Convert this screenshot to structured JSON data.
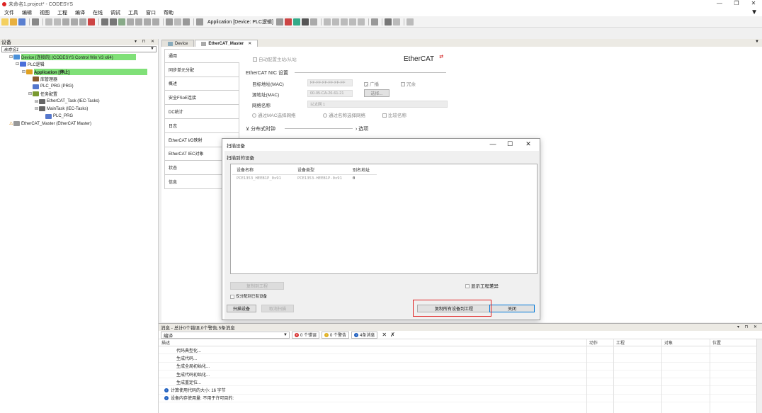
{
  "window": {
    "title": "未命名1.project* - CODESYS",
    "controls": [
      "—",
      "❐",
      "✕"
    ]
  },
  "menu": [
    "文件",
    "编辑",
    "视图",
    "工程",
    "编译",
    "在线",
    "调试",
    "工具",
    "窗口",
    "帮助"
  ],
  "toolbar": {
    "application_label": "Application [Device: PLC逻辑]"
  },
  "devices_panel": {
    "title": "设备",
    "root": "未命名1",
    "tree": [
      {
        "indent": 1,
        "exp": "⊟",
        "label": "Device [连接的] (CODESYS Control Win V3 x64)",
        "highlight": true,
        "icon_color": "#4a90d9"
      },
      {
        "indent": 2,
        "exp": "⊟",
        "label": "PLC逻辑",
        "highlight": false,
        "icon_color": "#4a6fd9"
      },
      {
        "indent": 3,
        "exp": "⊟",
        "label": "Application [停止]",
        "highlight": "bold",
        "icon_color": "#e0a020"
      },
      {
        "indent": 4,
        "exp": "",
        "label": "库管理器",
        "highlight": false,
        "icon_color": "#8b5a2b"
      },
      {
        "indent": 4,
        "exp": "",
        "label": "PLC_PRG (PRG)",
        "highlight": false,
        "icon_color": "#5577cc"
      },
      {
        "indent": 4,
        "exp": "⊟",
        "label": "任务配置",
        "highlight": false,
        "icon_color": "#7a9a30"
      },
      {
        "indent": 5,
        "exp": "⊟",
        "label": "EtherCAT_Task (IEC-Tasks)",
        "highlight": false,
        "icon_color": "#666666"
      },
      {
        "indent": 5,
        "exp": "⊟",
        "label": "MainTask (IEC-Tasks)",
        "highlight": false,
        "icon_color": "#666666"
      },
      {
        "indent": 6,
        "exp": "",
        "label": "PLC_PRG",
        "highlight": false,
        "icon_color": "#5577cc"
      },
      {
        "indent": 1,
        "exp": "⚠",
        "label": "EtherCAT_Master (EtherCAT Master)",
        "highlight": false,
        "icon_color": "#999999"
      }
    ]
  },
  "editor": {
    "tabs": [
      {
        "label": "Device",
        "active": false
      },
      {
        "label": "EtherCAT_Master",
        "active": true
      }
    ],
    "side_tabs": [
      "通用",
      "同步单元分配",
      "概述",
      "安全FSoE连接",
      "DC统计",
      "日志",
      "EtherCAT I/O映射",
      "EtherCAT IEC对象",
      "状态",
      "信息"
    ],
    "general": {
      "auto_config": "自动配置主站/从站",
      "nic_heading": "EtherCAT NIC 设置",
      "dest_addr_label": "目标地址(MAC)",
      "dest_addr_value": "FF-FF-FF-FF-FF-FF",
      "broadcast": "广播",
      "redundancy": "冗余",
      "src_addr_label": "源地址(MAC)",
      "src_addr_value": "00-05-CA-26-61-21",
      "browse": "选择...",
      "network_name_label": "网络名称",
      "network_name_value": "以太网 1",
      "opt_mac": "通过MAC选择网络",
      "opt_name": "通过名称选择网络",
      "opt_compat": "比较名称",
      "dc_heading": "分布式时钟",
      "options_heading": "选项",
      "logo_text": "EtherCAT"
    }
  },
  "scan_dialog": {
    "title": "扫描设备",
    "section": "扫描到的设备",
    "columns": [
      "设备名称",
      "设备类型",
      "别名地址"
    ],
    "rows": [
      {
        "name": "PCE1353_HEEB1P_0x91",
        "type": "PCE1353-HEEB1P-0x91",
        "alias": "0"
      }
    ],
    "copy_btn": "复制到工程",
    "show_diff": "显示工程差异",
    "assign_only": "仅分配到已有设备",
    "scan_btn": "扫描设备",
    "cancel_scan_btn": "取消扫描",
    "copy_all_btn": "复制所有设备到工程",
    "close_btn": "关闭"
  },
  "messages": {
    "header": "消息 - 总计0个错误,0个警告,5条消息",
    "filter_value": "编译",
    "errors": "0 个错误",
    "warnings": "0 个警告",
    "infos": "4条消息",
    "columns": [
      "描述",
      "动作",
      "工程",
      "对象",
      "位置"
    ],
    "rows": [
      {
        "icon": "",
        "text": "代码典型化..."
      },
      {
        "icon": "",
        "text": "生成代码..."
      },
      {
        "icon": "",
        "text": "生成全局初始化..."
      },
      {
        "icon": "",
        "text": "生成代码初始化..."
      },
      {
        "icon": "",
        "text": "生成重定位..."
      },
      {
        "icon": "info",
        "text": "计算使用代码的大小: 16 字节"
      },
      {
        "icon": "info",
        "text": "设备内存使用量: 不用于许可目的:"
      }
    ]
  },
  "colors": {
    "highlight": "#80e078",
    "accent": "#0078d7",
    "red_box": "#e02020",
    "error": "#d83030",
    "warning": "#e0b020",
    "info": "#2060c0"
  }
}
